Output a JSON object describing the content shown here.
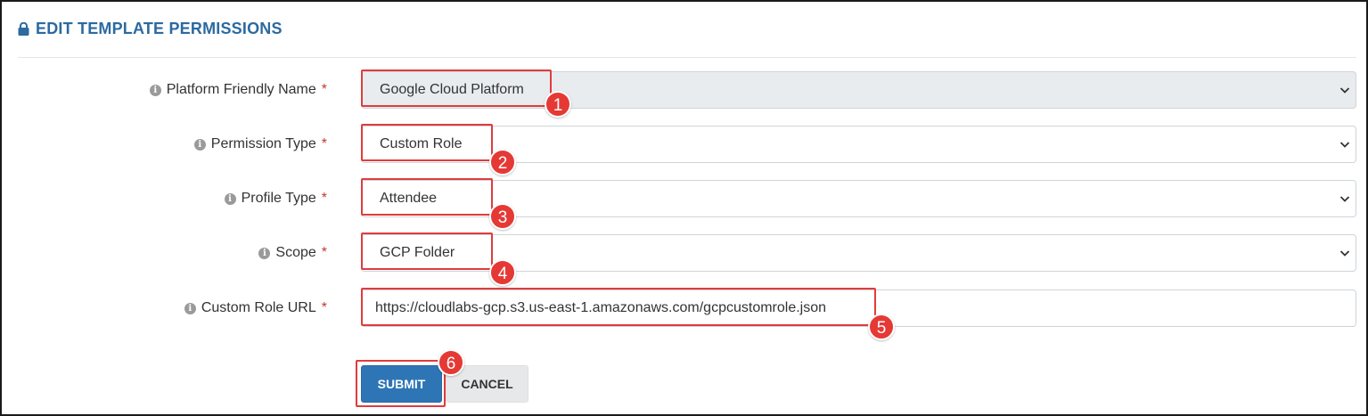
{
  "header": {
    "title": "EDIT TEMPLATE PERMISSIONS",
    "icon": "lock-icon"
  },
  "required_marker": "*",
  "info_glyph": "i",
  "fields": [
    {
      "label": "Platform Friendly Name",
      "value": "Google Cloud Platform",
      "type": "select",
      "disabled": true
    },
    {
      "label": "Permission Type",
      "value": "Custom Role",
      "type": "select"
    },
    {
      "label": "Profile Type",
      "value": "Attendee",
      "type": "select"
    },
    {
      "label": "Scope",
      "value": "GCP Folder",
      "type": "select"
    },
    {
      "label": "Custom Role URL",
      "value": "https://cloudlabs-gcp.s3.us-east-1.amazonaws.com/gcpcustomrole.json",
      "type": "text"
    }
  ],
  "buttons": {
    "submit": "SUBMIT",
    "cancel": "CANCEL"
  },
  "annotations": [
    "1",
    "2",
    "3",
    "4",
    "5",
    "6"
  ],
  "colors": {
    "accent": "#2c6aa0",
    "required": "#c0392b",
    "highlight": "#e03c3c",
    "badge": "#e53935",
    "submit": "#2e75b6",
    "readonly_bg": "#e9ecef"
  }
}
